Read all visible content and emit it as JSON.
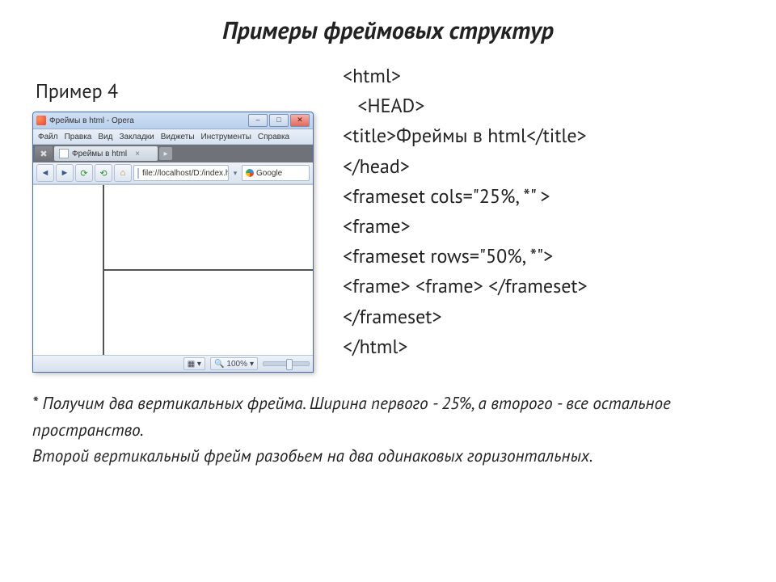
{
  "title": "Примеры фреймовых структур",
  "example_label": "Пример 4",
  "browser": {
    "window_title": "Фреймы в html - Opera",
    "menu": [
      "Файл",
      "Правка",
      "Вид",
      "Закладки",
      "Виджеты",
      "Инструменты",
      "Справка"
    ],
    "tab_label": "Фреймы в html",
    "url": "file://localhost/D:/index.html",
    "search_label": "Google",
    "zoom": "100%",
    "frame_layout": {
      "cols": "25%, *",
      "rows": "50%, *"
    }
  },
  "code": {
    "l1": "<html>",
    "l2": " <HEAD>",
    "l3": "<title>Фреймы в html</title>",
    "l4": "</head>",
    "l5": "<frameset cols=\"25%, *\" >",
    "l6": "<frame>",
    "l7": "<frameset rows=\"50%, *\">",
    "l8": "<frame> <frame> </frameset>",
    "l9": "</frameset>",
    "l10": "</html>"
  },
  "footnote": {
    "p1": "* Получим два вертикальных фрейма. Ширина первого - 25%, а второго - все остальное пространство.",
    "p2": "Второй вертикальный фрейм разобьем на два одинаковых горизонтальных."
  }
}
